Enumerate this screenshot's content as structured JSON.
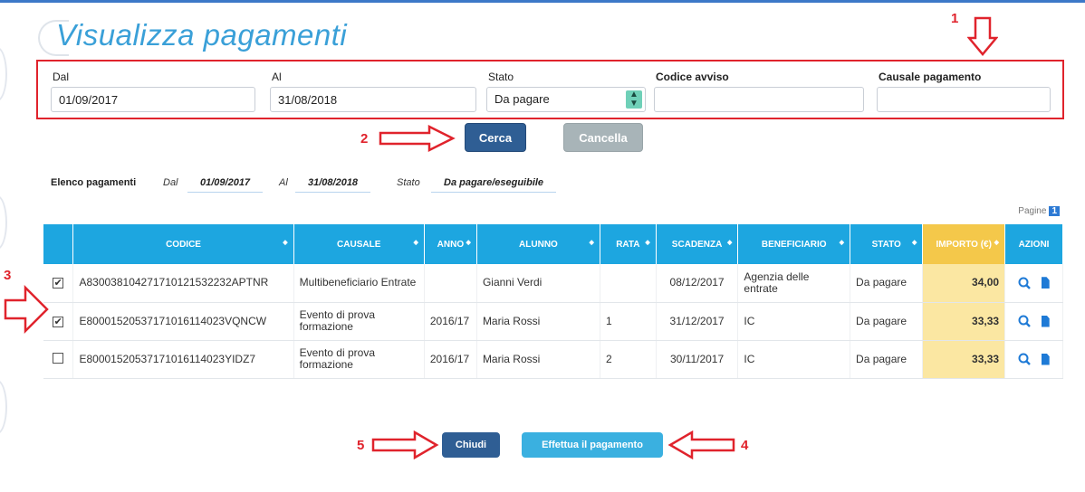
{
  "page": {
    "title": "Visualizza pagamenti"
  },
  "filters": {
    "dal_label": "Dal",
    "dal_value": "01/09/2017",
    "al_label": "Al",
    "al_value": "31/08/2018",
    "stato_label": "Stato",
    "stato_value": "Da pagare",
    "codice_label": "Codice avviso",
    "codice_value": "",
    "causale_label": "Causale pagamento",
    "causale_value": ""
  },
  "actions": {
    "cerca": "Cerca",
    "cancella": "Cancella",
    "chiudi": "Chiudi",
    "effettua": "Effettua il pagamento"
  },
  "annotations": [
    "1",
    "2",
    "3",
    "4",
    "5"
  ],
  "summary": {
    "label": "Elenco pagamenti",
    "dal_label": "Dal",
    "dal": "01/09/2017",
    "al_label": "Al",
    "al": "31/08/2018",
    "stato_label": "Stato",
    "stato": "Da pagare/eseguibile"
  },
  "pager": {
    "label": "Pagine",
    "page": "1"
  },
  "table": {
    "headers": [
      "CODICE",
      "CAUSALE",
      "ANNO",
      "ALUNNO",
      "RATA",
      "SCADENZA",
      "BENEFICIARIO",
      "STATO",
      "IMPORTO (€)",
      "AZIONI"
    ],
    "rows": [
      {
        "checked": true,
        "codice": "A830038104271710121532232APTNR",
        "causale": "Multibeneficiario Entrate",
        "anno": "",
        "alunno": "Gianni Verdi",
        "rata": "",
        "scadenza": "08/12/2017",
        "beneficiario": "Agenzia delle entrate",
        "stato": "Da pagare",
        "importo": "34,00"
      },
      {
        "checked": true,
        "codice": "E80001520537171016114023VQNCW",
        "causale": "Evento di prova formazione",
        "anno": "2016/17",
        "alunno": "Maria Rossi",
        "rata": "1",
        "scadenza": "31/12/2017",
        "beneficiario": "IC",
        "stato": "Da pagare",
        "importo": "33,33"
      },
      {
        "checked": false,
        "codice": "E80001520537171016114023YIDZ7",
        "causale": "Evento di prova formazione",
        "anno": "2016/17",
        "alunno": "Maria Rossi",
        "rata": "2",
        "scadenza": "30/11/2017",
        "beneficiario": "IC",
        "stato": "Da pagare",
        "importo": "33,33"
      }
    ]
  },
  "icons": [
    "magnifier-icon",
    "document-icon",
    "checkbox-checked-icon",
    "checkbox-empty-icon",
    "arrow-annotation-icon"
  ],
  "colors": {
    "header": "#1da6e0",
    "importo_header": "#f4c84a",
    "importo_cell": "#fbe7a2",
    "annotation": "#e0232c",
    "title": "#3aa0d8"
  }
}
